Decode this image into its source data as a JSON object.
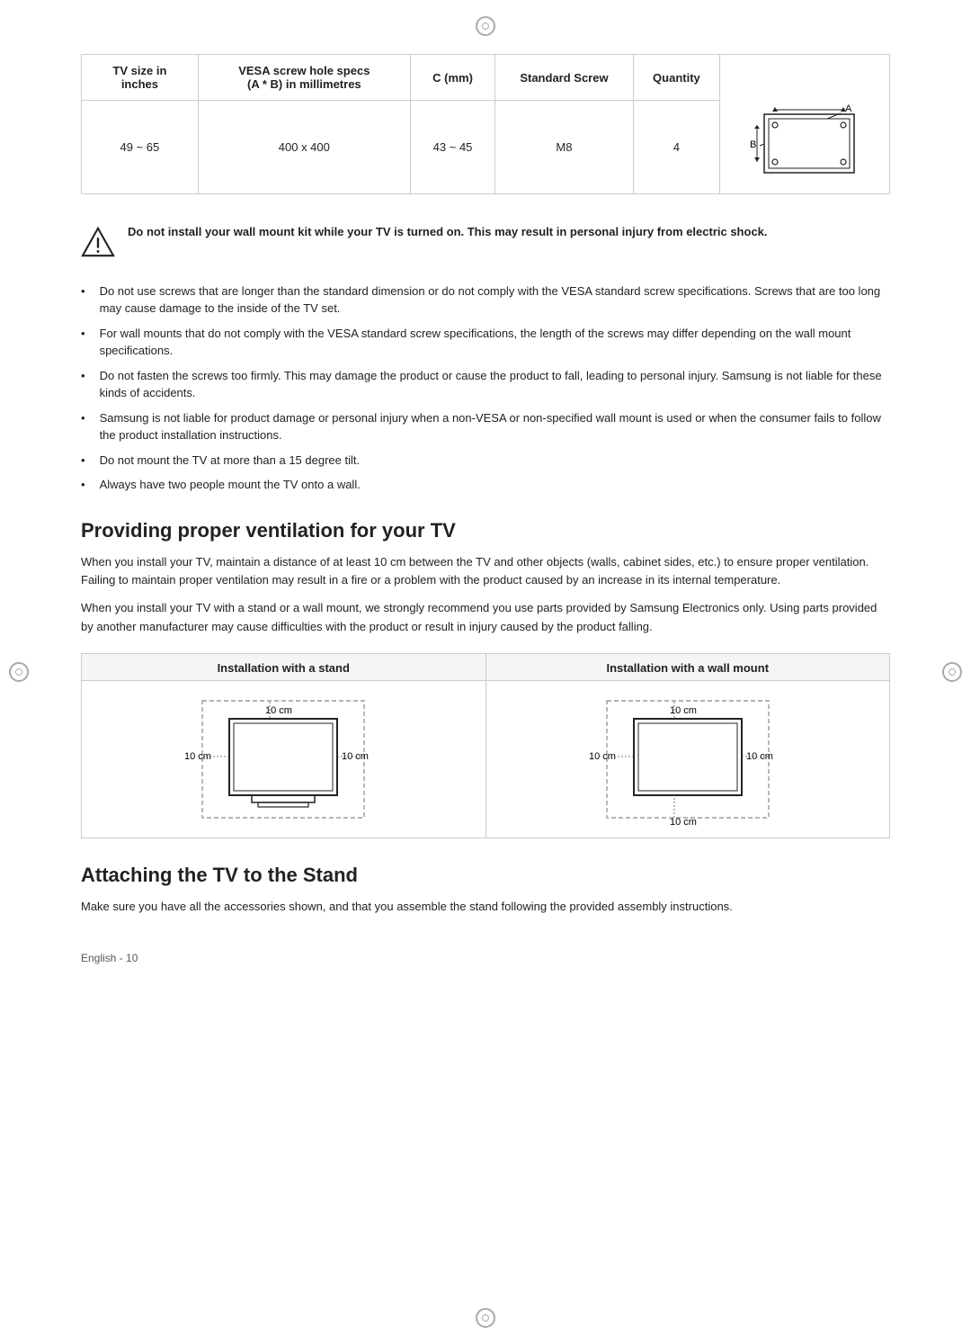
{
  "markers": {
    "top_label": "⊕",
    "bottom_label": "⊕",
    "left_label": "⊕",
    "right_label": "⊕"
  },
  "table": {
    "headers": [
      "TV size in\ninches",
      "VESA screw hole specs\n(A * B) in millimetres",
      "C (mm)",
      "Standard Screw",
      "Quantity"
    ],
    "row": {
      "tv_size": "49 ~ 65",
      "vesa": "400 x 400",
      "c_mm": "43 ~ 45",
      "screw": "M8",
      "quantity": "4"
    }
  },
  "warning": {
    "text": "Do not install your wall mount kit while your TV is turned on. This may result in personal injury from electric shock."
  },
  "bullets": [
    "Do not use screws that are longer than the standard dimension or do not comply with the VESA standard screw specifications. Screws that are too long may cause damage to the inside of the TV set.",
    "For wall mounts that do not comply with the VESA standard screw specifications, the length of the screws may differ depending on the wall mount specifications.",
    "Do not fasten the screws too firmly. This may damage the product or cause the product to fall, leading to personal injury. Samsung is not liable for these kinds of accidents.",
    "Samsung is not liable for product damage or personal injury when a non-VESA or non-specified wall mount is used or when the consumer fails to follow the product installation instructions.",
    "Do not mount the TV at more than a 15 degree tilt.",
    "Always have two people mount the TV onto a wall."
  ],
  "ventilation_section": {
    "heading": "Providing proper ventilation for your TV",
    "paragraph1": "When you install your TV, maintain a distance of at least 10 cm between the TV and other objects (walls, cabinet sides, etc.) to ensure proper ventilation. Failing to maintain proper ventilation may result in a fire or a problem with the product caused by an increase in its internal temperature.",
    "paragraph2": "When you install your TV with a stand or a wall mount, we strongly recommend you use parts provided by Samsung Electronics only. Using parts provided by another manufacturer may cause difficulties with the product or result in injury caused by the product falling."
  },
  "installation_diagrams": {
    "stand": {
      "title": "Installation with a stand",
      "label_top": "10 cm",
      "label_left": "10 cm",
      "label_right": "10 cm"
    },
    "wall": {
      "title": "Installation with a wall mount",
      "label_top": "10 cm",
      "label_left": "10 cm",
      "label_right": "10 cm",
      "label_bottom": "10 cm"
    }
  },
  "attaching_section": {
    "heading": "Attaching the TV to the Stand",
    "paragraph": "Make sure you have all the accessories shown, and that you assemble the stand following the provided assembly instructions."
  },
  "footer": {
    "text": "English - 10"
  }
}
